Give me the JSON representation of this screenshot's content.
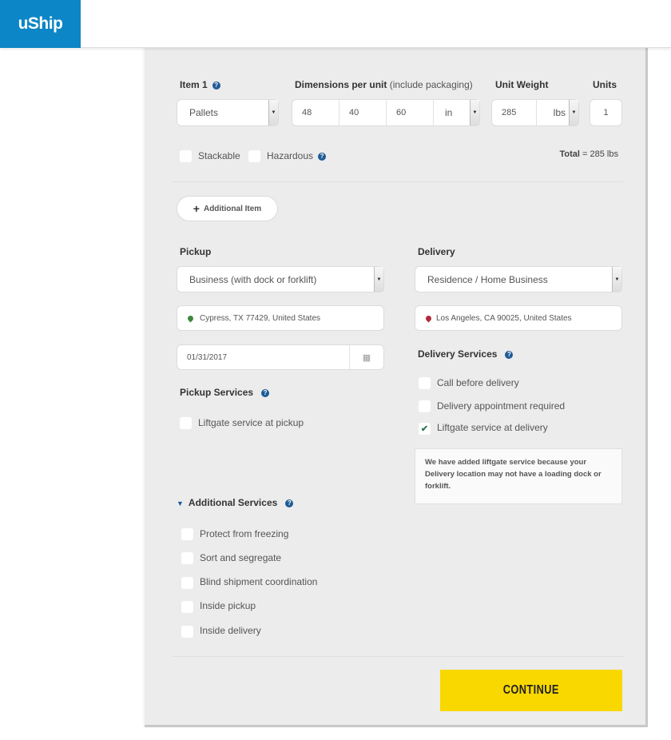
{
  "header": {
    "logo_text": "uShip",
    "brand_color": "#0c86c6"
  },
  "item": {
    "label": "Item 1",
    "dimensions_label": "Dimensions per unit",
    "dimensions_hint": "(include packaging)",
    "unit_weight_label": "Unit Weight",
    "units_label": "Units",
    "type_value": "Pallets",
    "length": "48",
    "width": "40",
    "height": "60",
    "dim_unit": "in",
    "weight": "285",
    "weight_unit": "lbs",
    "units": "1",
    "stackable_label": "Stackable",
    "hazardous_label": "Hazardous",
    "total_label": "Total",
    "total_value": "= 285 lbs"
  },
  "additional_item_button": "Additional Item",
  "pickup": {
    "label": "Pickup",
    "type_value": "Business (with dock or forklift)",
    "location": "Cypress, TX 77429, United States",
    "date": "01/31/2017",
    "services_label": "Pickup Services",
    "services": [
      {
        "label": "Liftgate service at pickup",
        "checked": false
      }
    ]
  },
  "delivery": {
    "label": "Delivery",
    "type_value": "Residence / Home Business",
    "location": "Los Angeles, CA 90025, United States",
    "services_label": "Delivery Services",
    "services": [
      {
        "label": "Call before delivery",
        "checked": false
      },
      {
        "label": "Delivery appointment required",
        "checked": false
      },
      {
        "label": "Liftgate service at delivery",
        "checked": true
      }
    ],
    "note": "We have added liftgate service because your Delivery location may not have a loading dock or forklift."
  },
  "additional_services": {
    "label": "Additional Services",
    "items": [
      {
        "label": "Protect from freezing",
        "checked": false
      },
      {
        "label": "Sort and segregate",
        "checked": false
      },
      {
        "label": "Blind shipment coordination",
        "checked": false
      },
      {
        "label": "Inside pickup",
        "checked": false
      },
      {
        "label": "Inside delivery",
        "checked": false
      }
    ]
  },
  "continue_button": "CONTINUE",
  "colors": {
    "accent_yellow": "#f9d800",
    "help_blue": "#1e5a96",
    "check_green": "#2a7a55"
  }
}
